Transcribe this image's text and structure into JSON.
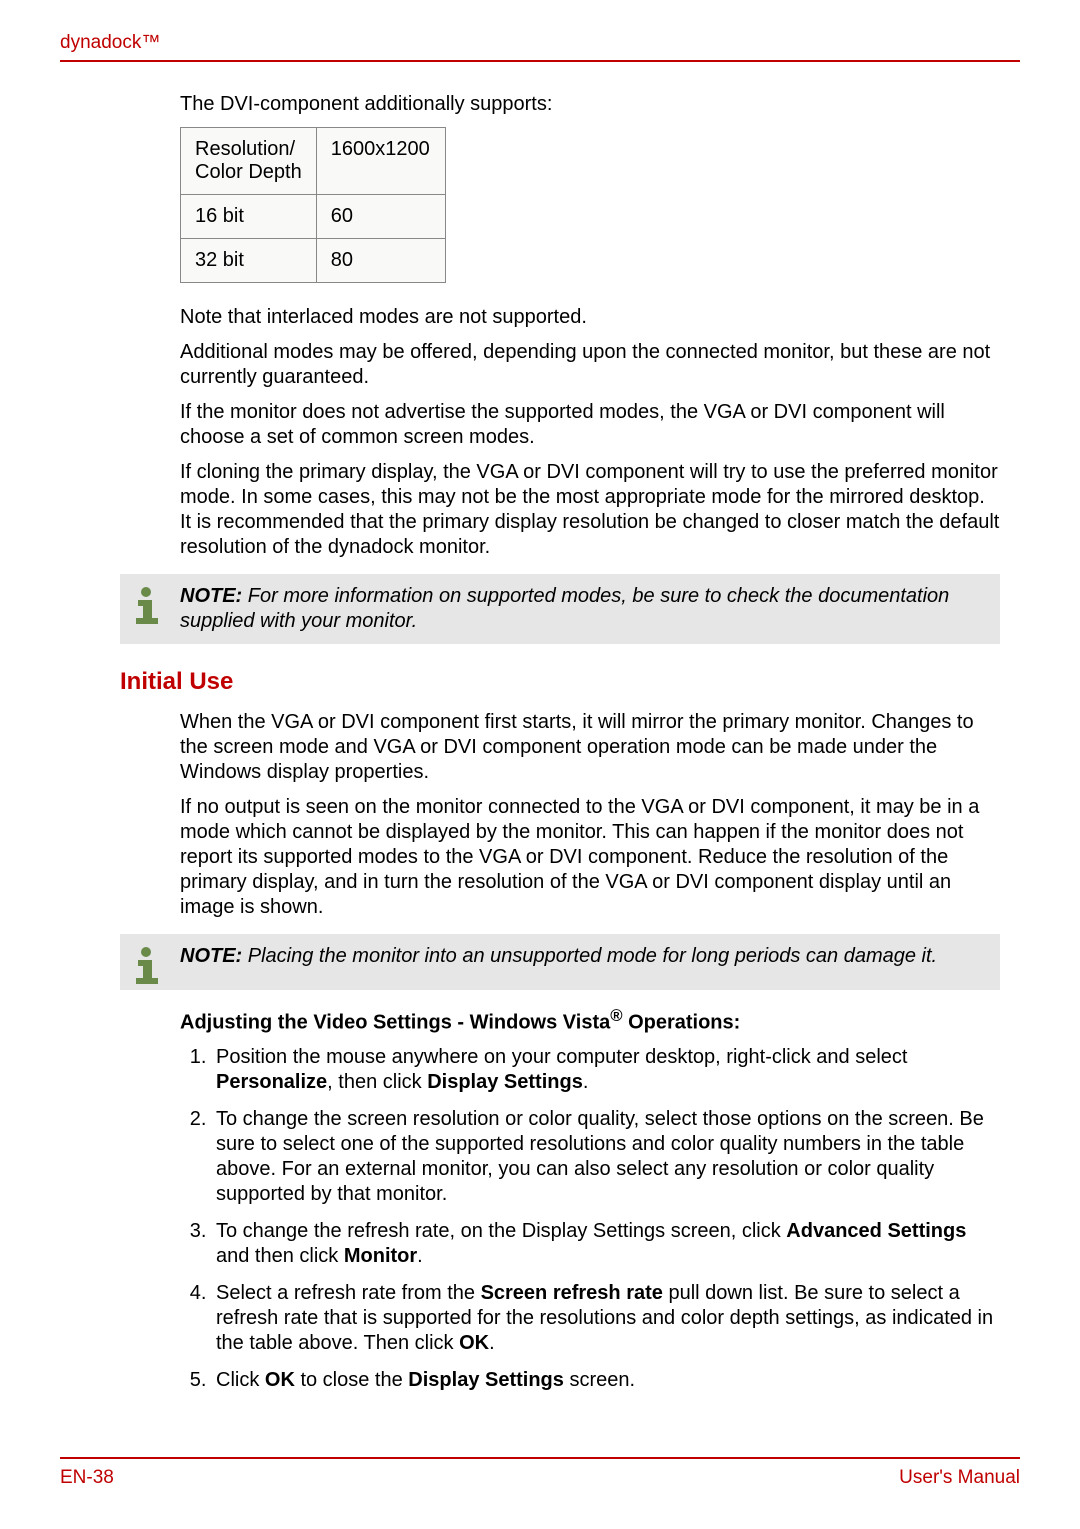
{
  "header": {
    "product": "dynadock™"
  },
  "intro": "The DVI-component additionally supports:",
  "table": {
    "header_left": "Resolution/\nColor Depth",
    "header_right": "1600x1200",
    "rows": [
      {
        "depth": "16 bit",
        "hz": "60"
      },
      {
        "depth": "32 bit",
        "hz": "80"
      }
    ]
  },
  "paragraphs": {
    "p1": "Note that interlaced modes are not supported.",
    "p2": "Additional modes may be offered, depending upon the connected monitor, but these are not currently guaranteed.",
    "p3": "If the monitor does not advertise the supported modes, the VGA or DVI component will choose a set of common screen modes.",
    "p4": "If cloning the primary display, the VGA or DVI component will try to use the preferred monitor mode. In some cases, this may not be the most appropriate mode for the mirrored desktop. It is recommended that the primary display resolution be changed to closer match the default resolution of the dynadock monitor."
  },
  "note1": {
    "label": "NOTE:",
    "text": " For more information on supported modes, be sure to check the documentation supplied with your monitor."
  },
  "section_heading": "Initial Use",
  "initial": {
    "p1": "When the VGA or DVI component first starts, it will mirror the primary monitor. Changes to the screen mode and VGA or DVI component operation mode can be made under the Windows display properties.",
    "p2": "If no output is seen on the monitor connected to the VGA or DVI component, it may be in a mode which cannot be displayed by the monitor. This can happen if the monitor does not report its supported modes to the VGA or DVI component. Reduce the resolution of the primary display, and in turn the resolution of the VGA or DVI component display until an image is shown."
  },
  "note2": {
    "label": "NOTE:",
    "text": " Placing the monitor into an unsupported mode for long periods can damage it."
  },
  "subheading": {
    "pre": "Adjusting the Video Settings - Windows Vista",
    "sup": "®",
    "post": " Operations:"
  },
  "steps": {
    "s1a": "Position the mouse anywhere on your computer desktop, right-click and select ",
    "s1b": "Personalize",
    "s1c": ", then click ",
    "s1d": "Display Settings",
    "s1e": ".",
    "s2": "To change the screen resolution or color quality, select those options on the screen. Be sure to select one of the supported resolutions and color quality numbers in the table above. For an external monitor, you can also select any resolution or color quality supported by that monitor.",
    "s3a": "To change the refresh rate, on the Display Settings screen, click ",
    "s3b": "Advanced Settings",
    "s3c": " and then click ",
    "s3d": "Monitor",
    "s3e": ".",
    "s4a": "Select a refresh rate from the ",
    "s4b": "Screen refresh rate",
    "s4c": " pull down list. Be sure to select a refresh rate that is supported for the resolutions and color depth settings, as indicated in the table above. Then click ",
    "s4d": "OK",
    "s4e": ".",
    "s5a": "Click ",
    "s5b": "OK",
    "s5c": " to close the ",
    "s5d": "Display Settings",
    "s5e": " screen."
  },
  "footer": {
    "page": "EN-38",
    "doc": "User's Manual"
  }
}
